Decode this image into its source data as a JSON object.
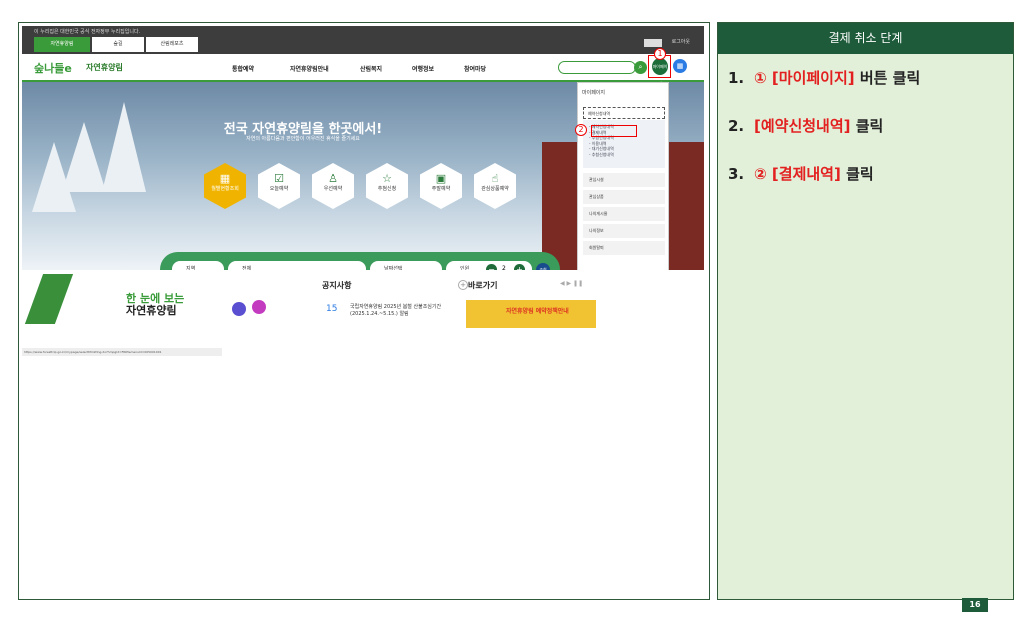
{
  "screenshot": {
    "notice": "이 누리집은 대한민국 공식 전자정부 누리집입니다.",
    "site_tabs": [
      "자연휴양림",
      "숲길",
      "산림레포츠"
    ],
    "login": "로그아웃",
    "logo": "숲나들e",
    "brand": "자연휴양림",
    "menu": [
      "통합예약",
      "자연휴양림안내",
      "산림복지",
      "여행정보",
      "참여마당"
    ],
    "my_button": "마이페이지",
    "hero_title": "전국 자연휴양림을 한곳에서!",
    "hero_sub": "자연의 아름다움과 편안함이 어우러진 휴식을 즐기세요",
    "hex_buttons": [
      "월별현황조회",
      "오늘예약",
      "우선예약",
      "추첨신청",
      "주말예약",
      "관심상품예약"
    ],
    "search": {
      "region": "지역",
      "all": "전체",
      "date": "날짜선택",
      "people_label": "인원",
      "people_count": "2",
      "go": "조회"
    },
    "dropdown": {
      "header": "마이페이지",
      "sub": "예약신청내역",
      "list": [
        "- 예약신청내역",
        "- 결제내역",
        "- 추첨신청내역",
        "- 이용내역",
        "- 대기신청내역",
        "- 추첨신청내역"
      ],
      "items": [
        "관심시설",
        "관심상품",
        "나의게시물",
        "나의정보",
        "회원탈퇴"
      ]
    },
    "bottom": {
      "title1": "한 눈에 보는",
      "title2": "자연휴양림",
      "notice_title": "공지사항",
      "notice_day": "15",
      "notice_text": "국립자연휴양림 2025년 봄철 산불조심기간(2025.1.24.~5.15.) 알림",
      "quick_title": "바로가기",
      "banner": "자연휴양림 예약정책안내",
      "url": "https://www.foresttrip.go.kr/mypage/selectMmWlng.do?hmpgId=FRIP&menuId=005001001"
    },
    "markers": [
      "1",
      "2"
    ]
  },
  "panel": {
    "title": "결제 취소 단계",
    "steps": [
      {
        "num": "1.",
        "highlight": "① [마이페이지]",
        "rest": " 버튼 클릭"
      },
      {
        "num": "2.",
        "highlight": "[예약신청내역]",
        "rest": " 클릭"
      },
      {
        "num": "3.",
        "highlight": "② [결제내역]",
        "rest": " 클릭"
      }
    ]
  },
  "page_number": "16",
  "colors": {
    "accent": "#1e5b3a",
    "highlight": "#e32020",
    "panel_bg": "#e2f0d9"
  }
}
